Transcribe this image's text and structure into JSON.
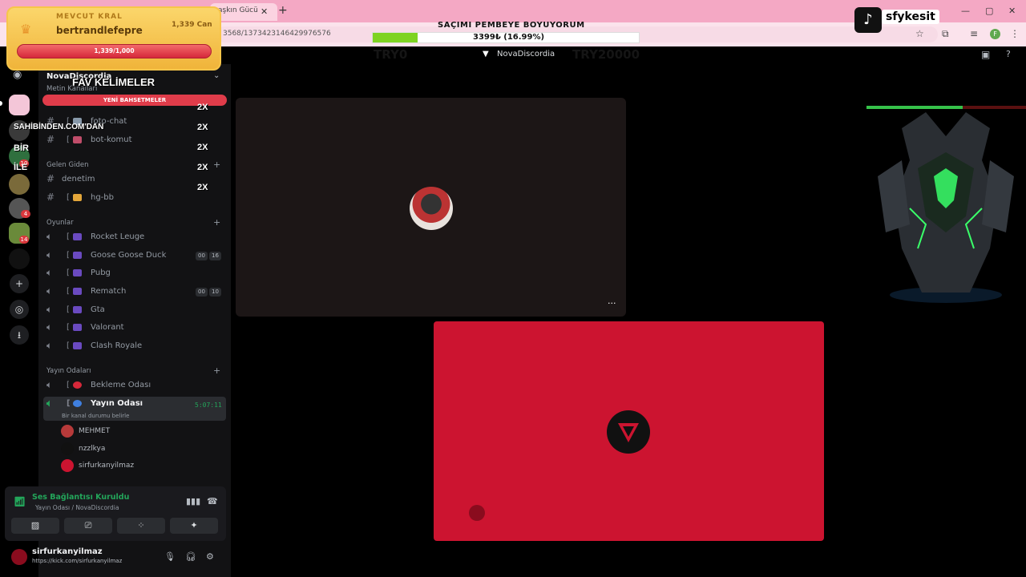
{
  "browser": {
    "tab_label": "aşkın Gücü",
    "url": "3568/1373423146429976576"
  },
  "header": {
    "server_label": "NovaDiscordia",
    "ghost_left": "TRY0",
    "ghost_right": "TRY20000"
  },
  "overlay_kral": {
    "title": "MEVCUT KRAL",
    "user": "bertrandlefepre",
    "can": "1,339 Can",
    "progress_text": "1,339/1,000"
  },
  "overlay_goal": {
    "title": "SAÇIMI PEMBEYE BOYUYORUM",
    "progress_text": "3399₺ (16.99%)",
    "progress": 0.1699
  },
  "overlay_tiktok": {
    "handle": "sfykesit"
  },
  "overlay_fav": {
    "title": "FAV KELİMELER",
    "subtitle": "YENİ BAHSETMELER",
    "ranks": [
      "SAHİBİNDEN.COM'DAN",
      "BİR",
      "İLE"
    ],
    "multipliers": [
      "2X",
      "2X",
      "2X",
      "2X",
      "2X"
    ]
  },
  "sidebar": {
    "server_name": "NovaDiscordia",
    "obscured_category": "Metin Kanalları",
    "channels_top": [
      {
        "label": "foto-chat"
      },
      {
        "label": "bot-komut"
      }
    ],
    "cat_gelen": "Gelen Giden",
    "channels_gelen": [
      {
        "label": "denetim"
      },
      {
        "label": "hg-bb"
      }
    ],
    "cat_oyunlar": "Oyunlar",
    "games": [
      {
        "label": "Rocket Leuge",
        "c1": "",
        "c2": ""
      },
      {
        "label": "Goose Goose Duck",
        "c1": "00",
        "c2": "16"
      },
      {
        "label": "Pubg",
        "c1": "",
        "c2": ""
      },
      {
        "label": "Rematch",
        "c1": "00",
        "c2": "10"
      },
      {
        "label": "Gta",
        "c1": "",
        "c2": ""
      },
      {
        "label": "Valorant",
        "c1": "",
        "c2": ""
      },
      {
        "label": "Clash Royale",
        "c1": "",
        "c2": ""
      }
    ],
    "cat_yayin": "Yayın Odaları",
    "bekleme": "Bekleme Odası",
    "yayin": "Yayın Odası",
    "timer": "5:07:11",
    "status_sub": "Bir kanal durumu belirle",
    "voice_users": [
      "MEHMET",
      "nzzlkya",
      "sirfurkanyilmaz"
    ]
  },
  "voice_panel": {
    "connected": "Ses Bağlantısı Kuruldu",
    "channel": "Yayın Odası / NovaDiscordia"
  },
  "user_panel": {
    "name": "sirfurkanyilmaz",
    "status": "https://kick.com/sirfurkanyilmaz"
  },
  "colors": {
    "accent_red": "#cc1430",
    "online_green": "#23a55a",
    "goal_fill": "#7ed321"
  }
}
